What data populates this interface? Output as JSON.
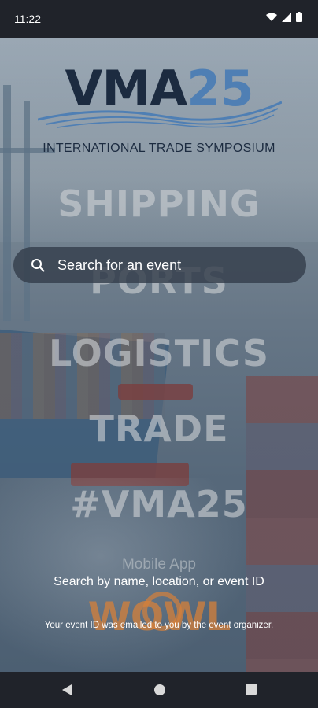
{
  "status_bar": {
    "time": "11:22",
    "icons": [
      "wifi-icon",
      "cell-signal-icon",
      "battery-icon"
    ]
  },
  "logo": {
    "brand_main": "VMA",
    "brand_year": "25",
    "subtitle": "INTERNATIONAL TRADE SYMPOSIUM",
    "colors": {
      "dark": "#1c2b40",
      "accent": "#4f7fb4"
    }
  },
  "background_words": [
    "SHIPPING",
    "PORTS",
    "LOGISTICS",
    "TRADE",
    "#VMA25"
  ],
  "search": {
    "placeholder": "Search for an event",
    "value": "",
    "icon": "search-icon"
  },
  "branding": {
    "mobile_app": "Mobile App",
    "wowl": "WOWL",
    "wowl_color": "#d6803a"
  },
  "help": {
    "main": "Search by name, location, or event ID",
    "sub": "Your event ID was emailed to you by the event organizer."
  },
  "nav_bar": {
    "buttons": [
      "back-icon",
      "home-icon",
      "recents-icon"
    ]
  }
}
